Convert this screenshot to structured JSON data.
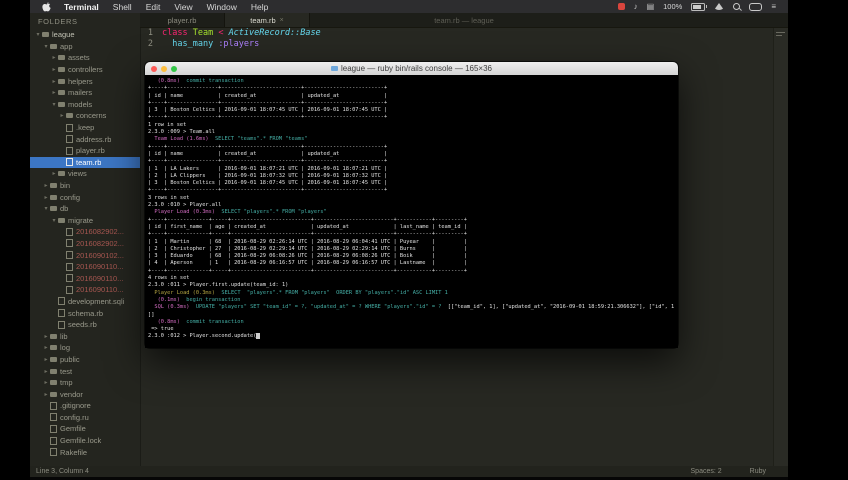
{
  "menubar": {
    "app_name": "Terminal",
    "items": [
      "Shell",
      "Edit",
      "View",
      "Window",
      "Help"
    ],
    "battery": "100%"
  },
  "window_title": "team.rb — league",
  "sidebar": {
    "header": "FOLDERS",
    "items": [
      {
        "label": "league",
        "indent": 0,
        "icon": "folder-open",
        "arrow": "▾",
        "top": true
      },
      {
        "label": "app",
        "indent": 1,
        "icon": "folder-open",
        "arrow": "▾"
      },
      {
        "label": "assets",
        "indent": 2,
        "icon": "folder",
        "arrow": "▸"
      },
      {
        "label": "controllers",
        "indent": 2,
        "icon": "folder",
        "arrow": "▸"
      },
      {
        "label": "helpers",
        "indent": 2,
        "icon": "folder",
        "arrow": "▸"
      },
      {
        "label": "mailers",
        "indent": 2,
        "icon": "folder",
        "arrow": "▸"
      },
      {
        "label": "models",
        "indent": 2,
        "icon": "folder-open",
        "arrow": "▾"
      },
      {
        "label": "concerns",
        "indent": 3,
        "icon": "folder",
        "arrow": "▸"
      },
      {
        "label": ".keep",
        "indent": 3,
        "icon": "file"
      },
      {
        "label": "address.rb",
        "indent": 3,
        "icon": "file"
      },
      {
        "label": "player.rb",
        "indent": 3,
        "icon": "file"
      },
      {
        "label": "team.rb",
        "indent": 3,
        "icon": "file",
        "selected": true
      },
      {
        "label": "views",
        "indent": 2,
        "icon": "folder",
        "arrow": "▸"
      },
      {
        "label": "bin",
        "indent": 1,
        "icon": "folder",
        "arrow": "▸"
      },
      {
        "label": "config",
        "indent": 1,
        "icon": "folder",
        "arrow": "▸"
      },
      {
        "label": "db",
        "indent": 1,
        "icon": "folder-open",
        "arrow": "▾"
      },
      {
        "label": "migrate",
        "indent": 2,
        "icon": "folder-open",
        "arrow": "▾"
      },
      {
        "label": "2016082902...",
        "indent": 3,
        "icon": "file",
        "red": true
      },
      {
        "label": "2016082902...",
        "indent": 3,
        "icon": "file",
        "red": true
      },
      {
        "label": "2016090102...",
        "indent": 3,
        "icon": "file",
        "red": true
      },
      {
        "label": "2016090110...",
        "indent": 3,
        "icon": "file",
        "red": true
      },
      {
        "label": "2016090110...",
        "indent": 3,
        "icon": "file",
        "red": true
      },
      {
        "label": "2016090110...",
        "indent": 3,
        "icon": "file",
        "red": true
      },
      {
        "label": "development.sqli",
        "indent": 2,
        "icon": "file"
      },
      {
        "label": "schema.rb",
        "indent": 2,
        "icon": "file"
      },
      {
        "label": "seeds.rb",
        "indent": 2,
        "icon": "file"
      },
      {
        "label": "lib",
        "indent": 1,
        "icon": "folder",
        "arrow": "▸"
      },
      {
        "label": "log",
        "indent": 1,
        "icon": "folder",
        "arrow": "▸"
      },
      {
        "label": "public",
        "indent": 1,
        "icon": "folder",
        "arrow": "▸"
      },
      {
        "label": "test",
        "indent": 1,
        "icon": "folder",
        "arrow": "▸"
      },
      {
        "label": "tmp",
        "indent": 1,
        "icon": "folder",
        "arrow": "▸"
      },
      {
        "label": "vendor",
        "indent": 1,
        "icon": "folder",
        "arrow": "▸"
      },
      {
        "label": ".gitignore",
        "indent": 1,
        "icon": "file"
      },
      {
        "label": "config.ru",
        "indent": 1,
        "icon": "file"
      },
      {
        "label": "Gemfile",
        "indent": 1,
        "icon": "file"
      },
      {
        "label": "Gemfile.lock",
        "indent": 1,
        "icon": "file"
      },
      {
        "label": "Rakefile",
        "indent": 1,
        "icon": "file"
      }
    ]
  },
  "tabs": [
    {
      "label": "player.rb",
      "active": false
    },
    {
      "label": "team.rb",
      "active": true,
      "close": "×"
    }
  ],
  "editor": {
    "lines": [
      {
        "num": "1",
        "segs": [
          [
            "class ",
            "kw"
          ],
          [
            "Team ",
            "cls"
          ],
          [
            "< ",
            "op"
          ],
          [
            "ActiveRecord::Base",
            "const"
          ]
        ]
      },
      {
        "num": "2",
        "segs": [
          [
            "  ",
            "pl"
          ],
          [
            "has_many ",
            "fn"
          ],
          [
            ":players",
            "sym"
          ]
        ]
      }
    ]
  },
  "terminal": {
    "title": "league — ruby bin/rails console — 165×36",
    "lines": [
      [
        [
          "   (0.8ms)  ",
          "m"
        ],
        [
          "commit transaction",
          "c"
        ]
      ],
      [
        [
          "+----+----------------+-------------------------+-------------------------+",
          "w"
        ]
      ],
      [
        [
          "| id | name           | created_at              | updated_at              |",
          "w"
        ]
      ],
      [
        [
          "+----+----------------+-------------------------+-------------------------+",
          "w"
        ]
      ],
      [
        [
          "| 3  | Boston Celtics | 2016-09-01 18:07:45 UTC | 2016-09-01 18:07:45 UTC |",
          "w"
        ]
      ],
      [
        [
          "+----+----------------+-------------------------+-------------------------+",
          "w"
        ]
      ],
      [
        [
          "1 row in set",
          "w"
        ]
      ],
      [
        [
          "2.3.0 :009 > Team.all",
          "w"
        ]
      ],
      [
        [
          "  ",
          "w"
        ],
        [
          "Team Load (1.6ms)  ",
          "m"
        ],
        [
          "SELECT \"teams\".* FROM \"teams\"",
          "c"
        ]
      ],
      [
        [
          "+----+----------------+-------------------------+-------------------------+",
          "w"
        ]
      ],
      [
        [
          "| id | name           | created_at              | updated_at              |",
          "w"
        ]
      ],
      [
        [
          "+----+----------------+-------------------------+-------------------------+",
          "w"
        ]
      ],
      [
        [
          "| 1  | LA Lakers      | 2016-09-01 18:07:21 UTC | 2016-09-01 18:07:21 UTC |",
          "w"
        ]
      ],
      [
        [
          "| 2  | LA Clippers    | 2016-09-01 18:07:32 UTC | 2016-09-01 18:07:32 UTC |",
          "w"
        ]
      ],
      [
        [
          "| 3  | Boston Celtics | 2016-09-01 18:07:45 UTC | 2016-09-01 18:07:45 UTC |",
          "w"
        ]
      ],
      [
        [
          "+----+----------------+-------------------------+-------------------------+",
          "w"
        ]
      ],
      [
        [
          "3 rows in set",
          "w"
        ]
      ],
      [
        [
          "2.3.0 :010 > Player.all",
          "w"
        ]
      ],
      [
        [
          "  ",
          "w"
        ],
        [
          "Player Load (0.3ms)  ",
          "m"
        ],
        [
          "SELECT \"players\".* FROM \"players\"",
          "c"
        ]
      ],
      [
        [
          "+----+-------------+-----+-------------------------+-------------------------+-----------+---------+",
          "w"
        ]
      ],
      [
        [
          "| id | first_name  | age | created_at              | updated_at              | last_name | team_id |",
          "w"
        ]
      ],
      [
        [
          "+----+-------------+-----+-------------------------+-------------------------+-----------+---------+",
          "w"
        ]
      ],
      [
        [
          "| 1  | Martin      | 68  | 2016-08-29 02:26:14 UTC | 2016-08-29 06:04:41 UTC | Puyear    |         |",
          "w"
        ]
      ],
      [
        [
          "| 2  | Christopher | 27  | 2016-08-29 02:29:14 UTC | 2016-08-29 02:29:14 UTC | Burns     |         |",
          "w"
        ]
      ],
      [
        [
          "| 3  | Eduardo     | 68  | 2016-08-29 06:08:26 UTC | 2016-08-29 06:08:26 UTC | Boik      |         |",
          "w"
        ]
      ],
      [
        [
          "| 4  | Aperson     | 1   | 2016-08-29 06:16:57 UTC | 2016-08-29 06:16:57 UTC | Lastname  |         |",
          "w"
        ]
      ],
      [
        [
          "+----+-------------+-----+-------------------------+-------------------------+-----------+---------+",
          "w"
        ]
      ],
      [
        [
          "4 rows in set",
          "w"
        ]
      ],
      [
        [
          "2.3.0 :011 > Player.first.update(team_id: 1)",
          "w"
        ]
      ],
      [
        [
          "  ",
          "w"
        ],
        [
          "Player Load (0.3ms)  ",
          "y"
        ],
        [
          "SELECT  \"players\".* FROM \"players\"  ORDER BY \"players\".\"id\" ASC LIMIT 1",
          "c"
        ]
      ],
      [
        [
          "   ",
          "w"
        ],
        [
          "(0.1ms)  ",
          "m"
        ],
        [
          "begin transaction",
          "c"
        ]
      ],
      [
        [
          "  ",
          "w"
        ],
        [
          "SQL (0.3ms)  ",
          "m"
        ],
        [
          "UPDATE \"players\" SET \"team_id\" = ?, \"updated_at\" = ? WHERE \"players\".\"id\" = ?",
          "c"
        ],
        [
          "  [[\"team_id\", 1], [\"updated_at\", \"2016-09-01 18:59:21.306632\"], [\"id\", 1",
          "w"
        ]
      ],
      [
        [
          "]]",
          "w"
        ]
      ],
      [
        [
          "   ",
          "w"
        ],
        [
          "(0.8ms)  ",
          "m"
        ],
        [
          "commit transaction",
          "c"
        ]
      ],
      [
        [
          " => true",
          "w"
        ]
      ],
      [
        [
          "2.3.0 :012 > Player.second.update(",
          "w"
        ],
        [
          " ",
          "cur"
        ]
      ]
    ]
  },
  "statusbar": {
    "left": "Line 3, Column 4",
    "spaces": "Spaces: 2",
    "syntax": "Ruby"
  }
}
